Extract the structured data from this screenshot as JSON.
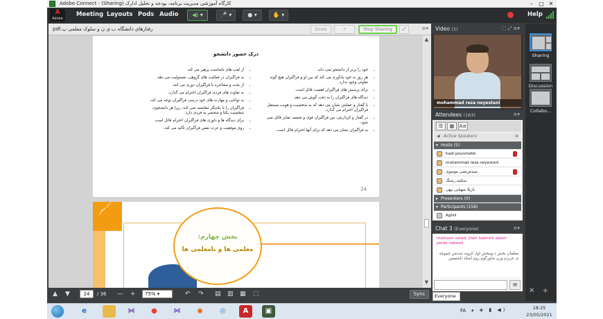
{
  "window": {
    "title": "Adobe Connect - (Sharing) کارگاه آموزشی مدیریت برنامه، بودجه و تحلیل ادارک"
  },
  "menubar": {
    "logo_text": "Adobe",
    "items": [
      "Meeting",
      "Layouts",
      "Pods",
      "Audio"
    ],
    "help_label": "Help"
  },
  "share_pod": {
    "document_name": "رفتارهای دانشگاه ب ی ن و سلوک معلمی پ.pdf",
    "draw_label": "Draw",
    "stop_sharing_label": "Stop Sharing"
  },
  "document": {
    "page1": {
      "heading": "درک حضور دانشجو",
      "right_bullets": [
        "خود را برتر از دانشجو نمی داند.",
        "هر روز به خود یادآوری می کند که بین او و فراگیران هیچ گونه تفاوتی وجود ندارد.",
        "برای پرسش های فراگیران اهمیت قائل است.",
        "دیدگاه های فراگیران را به دقت گوش می دهد.",
        "با گفتار و عملش نشان می دهد که به شخصیت و هویت مستقل فراگیران احترام می گذارد.",
        "در گفتار و کردارش، بین فراگیران قوی و ضعیف تمایز قائل نمی شود.",
        "به فراگیران نشان می دهد که برای آنها احترام قائل است."
      ],
      "left_bullets": [
        "از لقب های نامناسب پرهیز می کند.",
        "به فراگیران در فعالیت های گروهی، مسئولیت می دهد.",
        "از بحث و مشاجره با فراگیران دوری می کند.",
        "به تفاوت های فردی فراگیران احترام می گذارد.",
        "به توانایی و مهارت های خود درسی فراگیران توجه می کند.",
        "فراگیران را با یکدیگر مقایسه نمی کند، زیرا هر دانشجوی، شخصیت یکتا و منحصر به فردی دارد.",
        "برای دیدگاه ها و داوری های فراگیران احترام قائل است.",
        "روی موفقیت و عزت نفس فراگیران تأکید می کند."
      ],
      "page_number": "24"
    },
    "page2": {
      "corner_text": "درس معلمی",
      "title_line1": "بخش چهارم:",
      "title_line2": "معلمی ها و نامعلمی ها"
    }
  },
  "navbar": {
    "current_page": "24",
    "total_pages": "/ 36",
    "zoom": "75%",
    "sync_label": "Sync"
  },
  "video_pod": {
    "title": "Video",
    "count": "(1)",
    "speaker_name": "mohammad reza neyestani"
  },
  "attendees_pod": {
    "title": "Attendees",
    "count": "(163)",
    "active_speakers_label": "Active Speakers",
    "hosts_header": "Hosts (5)",
    "hosts": [
      {
        "name": "hadi pourshafei",
        "mic": true
      },
      {
        "name": "mohammad reza neyestani",
        "mic": false
      },
      {
        "name": "سیدمرتضی موسوی",
        "mic": true
      },
      {
        "name": "سکینه رشنگ",
        "mic": false
      },
      {
        "name": "نازیلا صهبایی بیهی",
        "mic": false
      }
    ],
    "presenters_header": "Presenters (0)",
    "participants_header": "Participants (158)",
    "participants": [
      {
        "name": "Aghili"
      }
    ]
  },
  "chat_pod": {
    "title": "Chat 3",
    "scope": "(Everyone)",
    "sender_line1": "mamoon ostad, cheh bakhshi azesh",
    "sender_line2": "peida nabood",
    "message": "معلمان بخش د ویبخش اول کرونه شدنش چیبوچه ی عزیزم ورن شاورگوم روم استاد ناشتمس",
    "recipient": "Everyone"
  },
  "layouts_rail": {
    "items": [
      "Sharing",
      "Discussion",
      "Collabo..."
    ]
  },
  "taskbar": {
    "language": "FA",
    "time": "18:25",
    "date": "23/05/2021"
  },
  "colors": {
    "accent_green": "#6bd34a",
    "record_red": "#e53935",
    "chat_pink": "#e01b8a",
    "slide_orange": "#f39c12"
  }
}
